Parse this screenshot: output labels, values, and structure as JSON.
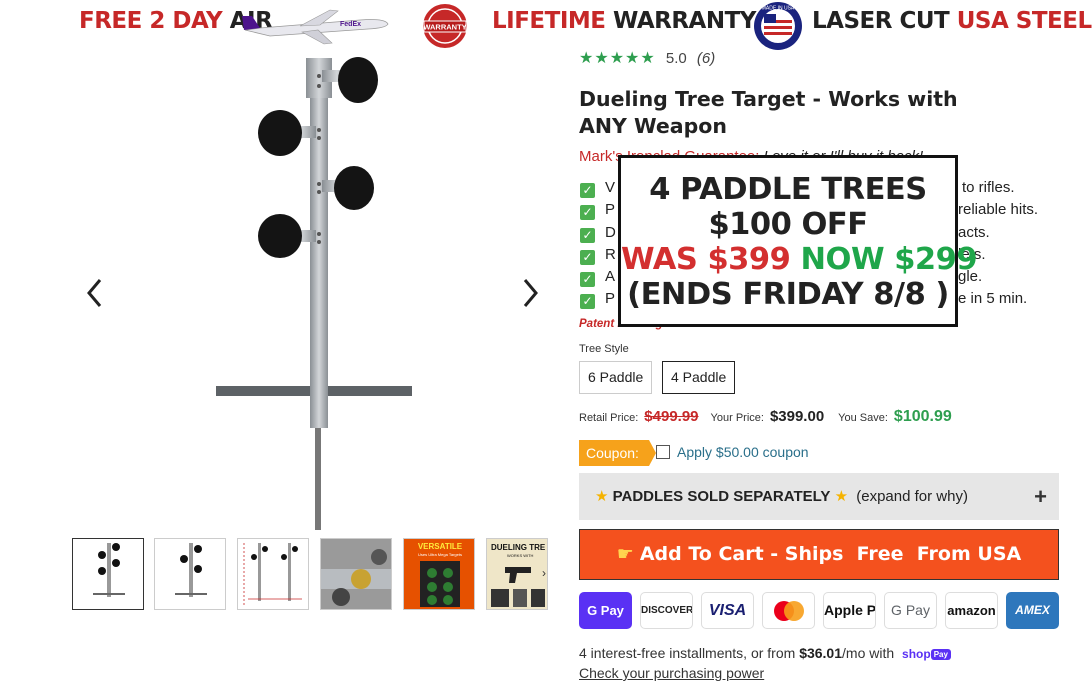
{
  "banner": {
    "free_prefix": "FREE 2 DAY",
    "free_suffix": "AIR",
    "plane_logo": "FedEx",
    "warranty_seal": "WARRANTY",
    "warranty_red": "LIFETIME",
    "warranty_dark": "WARRANTY",
    "usa_seal": "MADE IN USA",
    "laser_dark": "LASER CUT",
    "laser_red": "USA STEEL"
  },
  "gallery": {
    "prev_icon": "chevron-left-icon",
    "next_icon": "chevron-right-icon",
    "thumbs": [
      {
        "name": "thumb-4-paddle",
        "active": true
      },
      {
        "name": "thumb-2-paddle",
        "active": false
      },
      {
        "name": "thumb-dimensions",
        "active": false
      },
      {
        "name": "thumb-closeup",
        "active": false
      },
      {
        "name": "thumb-versatile",
        "active": false,
        "title": "VERSATILE",
        "sub": "Uses Ultra Mega Targets"
      },
      {
        "name": "thumb-dueling",
        "active": false,
        "title": "DUELING TRE",
        "sub": "WORKS WITH"
      }
    ]
  },
  "product": {
    "rating_stars": "★★★★★",
    "rating_value": "5.0",
    "rating_count": "(6)",
    "title": "Dueling Tree Target - Works with ANY Weapon",
    "guarantee_red": "Mark's Ironclad Guarantee:",
    "guarantee_text": "Love it or I'll buy it back!",
    "bullets": [
      {
        "start": "V",
        "end": "to rifles."
      },
      {
        "start": "P",
        "end": "reliable hits."
      },
      {
        "start": "D",
        "end": "acts."
      },
      {
        "start": "R",
        "end": "lets."
      },
      {
        "start": "A",
        "end": "gle."
      },
      {
        "start": "P",
        "end": "e in 5 min."
      }
    ],
    "patent": "Patent Pending",
    "tree_style_label": "Tree Style",
    "options": [
      "6 Paddle",
      "4 Paddle"
    ],
    "selected_option": "4 Paddle",
    "retail_label": "Retail Price:",
    "retail_price": "$499.99",
    "your_label": "Your Price:",
    "your_price": "$399.00",
    "save_label": "You Save:",
    "save_amount": "$100.99",
    "coupon_tag": "Coupon:",
    "coupon_text": "Apply $50.00 coupon",
    "paddles_bold": "PADDLES SOLD SEPARATELY",
    "paddles_note": "(expand for why)",
    "paddles_toggle": "+",
    "add_to_cart": "Add To Cart - Ships  Free  From USA",
    "payments": [
      "G Pay",
      "DISCOVER",
      "VISA",
      "Mastercard",
      "Apple Pay",
      "G Pay",
      "amazon",
      "AMEX"
    ],
    "installments_prefix": "4 interest-free installments, or from",
    "installments_amount": "$36.01",
    "installments_suffix": "/mo with",
    "shop_pay": "shop",
    "shop_pay_badge": "Pay",
    "purchasing_power": "Check your purchasing power"
  },
  "promo": {
    "line1": "4 PADDLE TREES",
    "line2": "$100 OFF",
    "was": "WAS $399",
    "now": "NOW $299",
    "line4": "(ENDS FRIDAY 8/8 )"
  },
  "colors": {
    "accent_red": "#c62828",
    "star_green": "#2e9e4f",
    "cart_orange": "#f4511e",
    "coupon_orange": "#f6a21b"
  }
}
